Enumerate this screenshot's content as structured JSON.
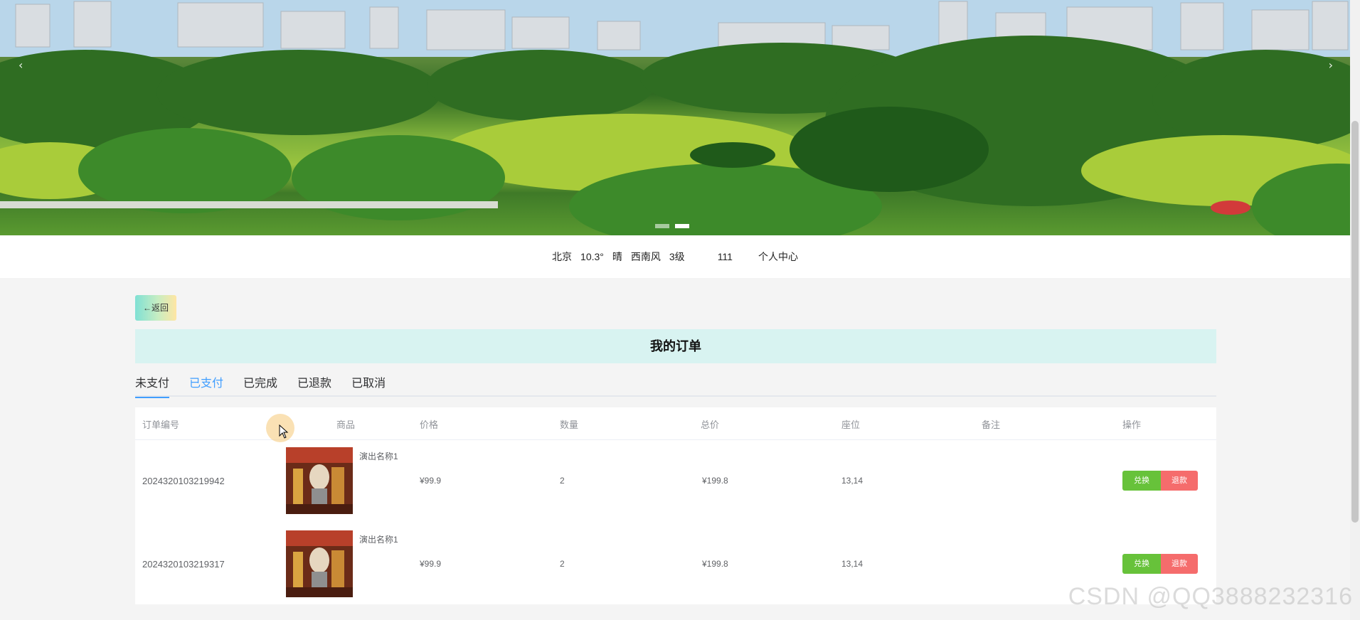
{
  "banner": {
    "prev_icon": "chevron-left-icon",
    "next_icon": "chevron-right-icon",
    "prev_glyph": "‹",
    "next_glyph": "›",
    "slide_count": 2,
    "active_slide": 2
  },
  "header": {
    "city": "北京",
    "temperature": "10.3°",
    "weather": "晴",
    "wind": "西南风",
    "wind_level": "3级",
    "user": "111",
    "profile_link": "个人中心"
  },
  "back_button": {
    "label": "←返回"
  },
  "page_title": "我的订单",
  "tabs": [
    {
      "label": "未支付",
      "active": true
    },
    {
      "label": "已支付",
      "active": false
    },
    {
      "label": "已完成",
      "active": false
    },
    {
      "label": "已退款",
      "active": false
    },
    {
      "label": "已取消",
      "active": false
    }
  ],
  "table": {
    "columns": [
      "订单编号",
      "商品",
      "价格",
      "数量",
      "总价",
      "座位",
      "备注",
      "操作"
    ],
    "rows": [
      {
        "order_no": "2024320103219942",
        "product_name": "演出名称1",
        "price": "¥99.9",
        "quantity": "2",
        "total": "¥199.8",
        "seat": "13,14",
        "remark": "",
        "action_primary": "兑换",
        "action_secondary": "退款"
      },
      {
        "order_no": "2024320103219317",
        "product_name": "演出名称1",
        "price": "¥99.9",
        "quantity": "2",
        "total": "¥199.8",
        "seat": "13,14",
        "remark": "",
        "action_primary": "兑换",
        "action_secondary": "退款"
      }
    ]
  },
  "watermark": "CSDN @QQ3888232316",
  "colors": {
    "tab_accent": "#409eff",
    "title_bg": "#d8f3f1",
    "btn_green": "#67c23a",
    "btn_red": "#f56c6c"
  }
}
